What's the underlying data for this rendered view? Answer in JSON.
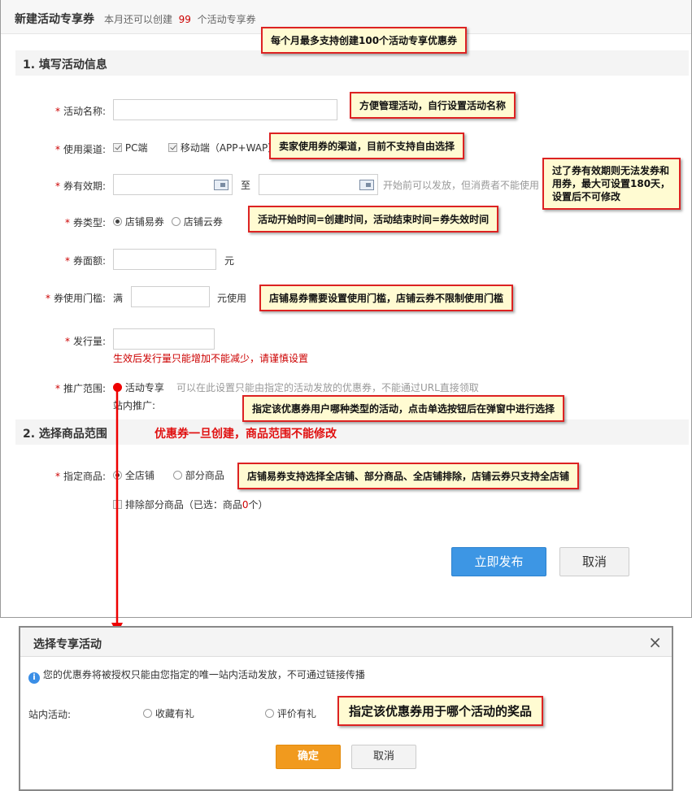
{
  "header": {
    "title": "新建活动专享券",
    "sub_prefix": "本月还可以创建",
    "remaining": "99",
    "sub_suffix": "个活动专享券"
  },
  "section1": {
    "title": "1. 填写活动信息"
  },
  "section2": {
    "title": "2. 选择商品范围",
    "warning": "优惠券一旦创建，商品范围不能修改"
  },
  "form": {
    "name": {
      "label": "活动名称:",
      "value": ""
    },
    "channel": {
      "label": "使用渠道:",
      "opt1": "PC端",
      "opt2": "移动端（APP+WAP）"
    },
    "validity": {
      "label": "券有效期:",
      "to": "至",
      "hint": "开始前可以发放，但消费者不能使用"
    },
    "type": {
      "label": "券类型:",
      "opt1": "店铺易券",
      "opt2": "店铺云券"
    },
    "face": {
      "label": "券面额:",
      "unit": "元"
    },
    "threshold": {
      "label": "券使用门槛:",
      "prefix": "满",
      "suffix": "元使用"
    },
    "issue": {
      "label": "发行量:",
      "warn": "生效后发行量只能增加不能减少，请谨慎设置"
    },
    "promo": {
      "label": "推广范围:",
      "option": "活动专享",
      "hint": "可以在此设置只能由指定的活动发放的优惠券，不能通过URL直接领取",
      "sub": "站内推广:"
    },
    "goods": {
      "label": "指定商品:",
      "opt1": "全店铺",
      "opt2": "部分商品",
      "exclude_prefix": "排除部分商品（已选：商品",
      "exclude_count": "0",
      "exclude_suffix": "个）"
    }
  },
  "buttons": {
    "publish": "立即发布",
    "cancel": "取消"
  },
  "notes": {
    "n1": "每个月最多支持创建100个活动专享优惠券",
    "n2": "方便管理活动，自行设置活动名称",
    "n3": "卖家使用券的渠道，目前不支持自由选择",
    "n4": "过了券有效期则无法发券和用券，最大可设置180天，设置后不可修改",
    "n5": "活动开始时间=创建时间，活动结束时间=券失效时间",
    "n6": "店铺易券需要设置使用门槛，店铺云券不限制使用门槛",
    "n7": "指定该优惠券用户哪种类型的活动，点击单选按钮后在弹窗中进行选择",
    "n8": "店铺易券支持选择全店铺、部分商品、全店铺排除，店铺云券只支持全店铺",
    "n9": "指定该优惠券用于哪个活动的奖品"
  },
  "dialog": {
    "title": "选择专享活动",
    "close": "×",
    "info": "您的优惠券将被授权只能由您指定的唯一站内活动发放，不可通过链接传播",
    "activity_label": "站内活动:",
    "opt1": "收藏有礼",
    "opt2": "评价有礼",
    "ok": "确定",
    "cancel": "取消"
  },
  "colors": {
    "accent": "#3d96e4",
    "required": "#cc0000",
    "note_border": "#dd2222",
    "note_bg": "#fffbd2",
    "ok": "#f19a1e"
  },
  "icons": {
    "calendar": "calendar-icon",
    "info": "info-icon",
    "close": "close-icon"
  }
}
